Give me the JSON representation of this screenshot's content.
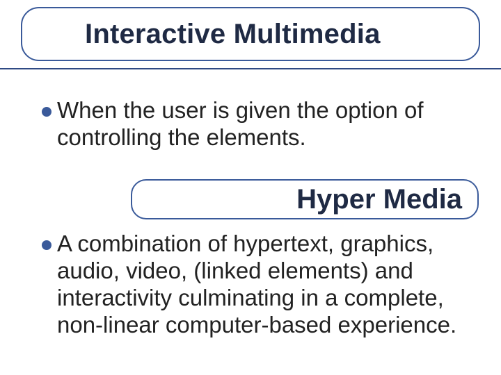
{
  "title": "Interactive Multimedia",
  "subheading": "Hyper Media",
  "bullets": {
    "b1": "When the user is given the option of controlling the elements.",
    "b2": "A combination of hypertext, graphics, audio, video, (linked elements) and interactivity culminating in a complete, non-linear computer-based experience."
  },
  "colors": {
    "accent": "#3a5a9a",
    "text": "#1f2a44"
  }
}
